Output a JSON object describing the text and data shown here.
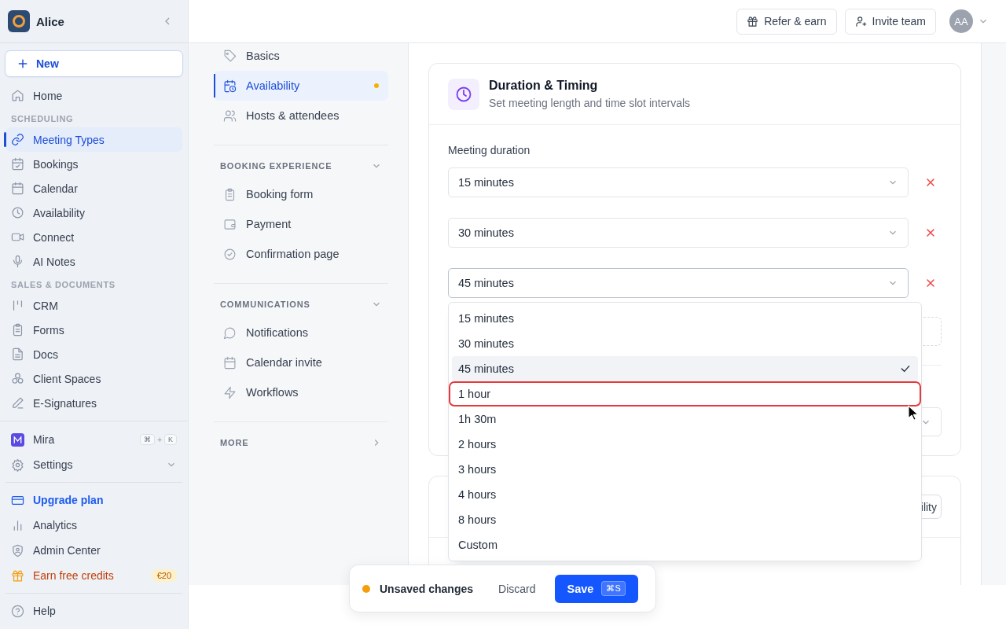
{
  "sidebar": {
    "workspace": "Alice",
    "new_label": "New",
    "nav": [
      {
        "kind": "item",
        "label": "Home",
        "selected": false
      },
      {
        "kind": "section",
        "label": "SCHEDULING"
      },
      {
        "kind": "item",
        "label": "Meeting Types",
        "selected": true
      },
      {
        "kind": "item",
        "label": "Bookings",
        "selected": false
      },
      {
        "kind": "item",
        "label": "Calendar",
        "selected": false
      },
      {
        "kind": "item",
        "label": "Availability",
        "selected": false
      },
      {
        "kind": "item",
        "label": "Connect",
        "selected": false
      },
      {
        "kind": "item",
        "label": "AI Notes",
        "selected": false
      },
      {
        "kind": "section",
        "label": "SALES & DOCUMENTS"
      },
      {
        "kind": "item",
        "label": "CRM",
        "selected": false
      },
      {
        "kind": "item",
        "label": "Forms",
        "selected": false
      },
      {
        "kind": "item",
        "label": "Docs",
        "selected": false
      },
      {
        "kind": "item",
        "label": "Client Spaces",
        "selected": false
      },
      {
        "kind": "item",
        "label": "E-Signatures",
        "selected": false
      }
    ],
    "mira": {
      "label": "Mira",
      "keys": [
        "⌘",
        "K"
      ],
      "joiner": "+"
    },
    "settings": {
      "label": "Settings",
      "expanded": false
    },
    "links": [
      {
        "kind": "accent",
        "label": "Upgrade plan"
      },
      {
        "kind": "plain",
        "label": "Analytics"
      },
      {
        "kind": "plain",
        "label": "Admin Center"
      },
      {
        "kind": "reward",
        "label": "Earn free credits",
        "badge": "€20"
      }
    ],
    "help": "Help"
  },
  "topbar": {
    "buttons": [
      "Refer & earn",
      "Invite team"
    ],
    "avatar": "AA"
  },
  "subnav": {
    "items": [
      {
        "label": "Basics",
        "selected": false,
        "modified": false
      },
      {
        "label": "Availability",
        "selected": true,
        "modified": true
      },
      {
        "label": "Hosts & attendees",
        "selected": false,
        "modified": false
      }
    ],
    "sections": [
      {
        "title": "BOOKING EXPERIENCE",
        "expanded": true,
        "items": [
          {
            "label": "Booking form",
            "selected": false
          },
          {
            "label": "Payment",
            "selected": false
          },
          {
            "label": "Confirmation page",
            "selected": false
          }
        ]
      },
      {
        "title": "COMMUNICATIONS",
        "expanded": true,
        "items": [
          {
            "label": "Notifications",
            "selected": false
          },
          {
            "label": "Calendar invite",
            "selected": false
          },
          {
            "label": "Workflows",
            "selected": false
          }
        ]
      },
      {
        "title": "MORE",
        "expanded": false
      }
    ]
  },
  "card": {
    "title": "Duration & Timing",
    "subtitle": "Set meeting length and time slot intervals",
    "field_label": "Meeting duration",
    "durations": [
      {
        "value": "15 minutes",
        "open": false
      },
      {
        "value": "30 minutes",
        "open": false
      },
      {
        "value": "45 minutes",
        "open": true
      }
    ],
    "options": [
      {
        "label": "15 minutes",
        "selected": false,
        "outlined": false
      },
      {
        "label": "30 minutes",
        "selected": false,
        "outlined": false
      },
      {
        "label": "45 minutes",
        "selected": true,
        "outlined": false
      },
      {
        "label": "1 hour",
        "selected": false,
        "outlined": true
      },
      {
        "label": "1h 30m",
        "selected": false,
        "outlined": false
      },
      {
        "label": "2 hours",
        "selected": false,
        "outlined": false
      },
      {
        "label": "3 hours",
        "selected": false,
        "outlined": false
      },
      {
        "label": "4 hours",
        "selected": false,
        "outlined": false
      },
      {
        "label": "8 hours",
        "selected": false,
        "outlined": false
      },
      {
        "label": "Custom",
        "selected": false,
        "outlined": false
      }
    ]
  },
  "second_card": {
    "button": "ility"
  },
  "unsaved_bar": {
    "message": "Unsaved changes",
    "discard": "Discard",
    "save": "Save",
    "shortcut": "⌘S"
  }
}
